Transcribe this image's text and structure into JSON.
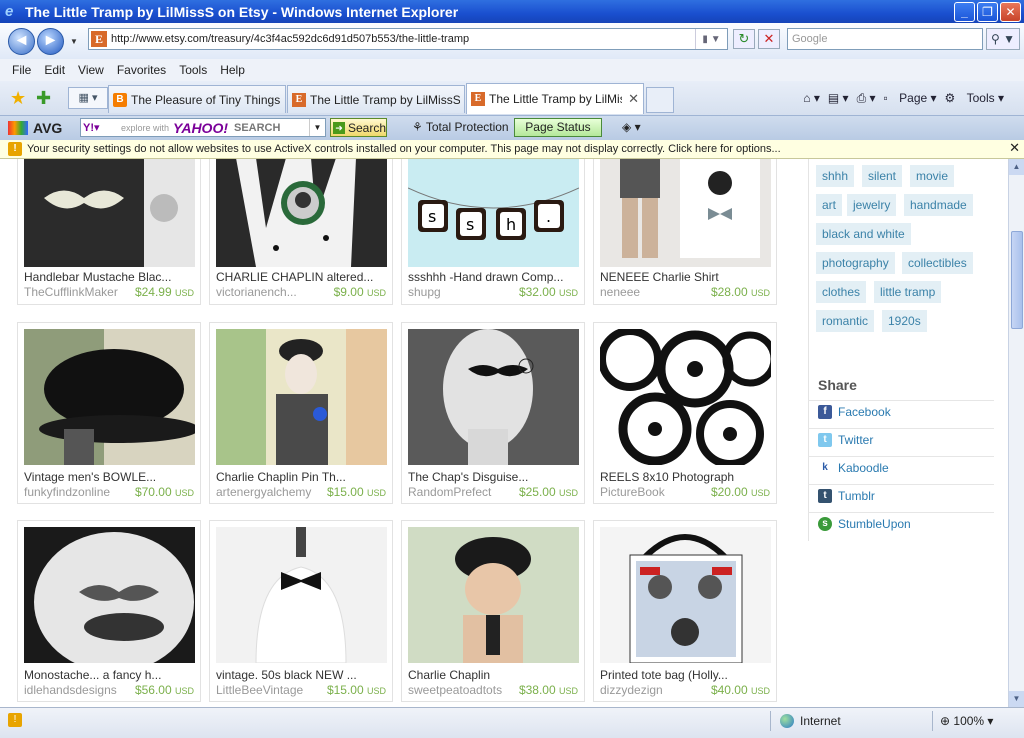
{
  "window": {
    "title": "The Little Tramp by LilMissS on Etsy - Windows Internet Explorer"
  },
  "address": {
    "url": "http://www.etsy.com/treasury/4c3f4ac592dc6d91d507b553/the-little-tramp",
    "search_placeholder": "Google"
  },
  "menu": [
    "File",
    "Edit",
    "View",
    "Favorites",
    "Tools",
    "Help"
  ],
  "tabs": [
    {
      "label": "The Pleasure of Tiny Things: ...",
      "icon": "blogger-icon"
    },
    {
      "label": "The Little Tramp by LilMissS o...",
      "icon": "etsy-icon"
    },
    {
      "label": "The Little Tramp by LilMis...",
      "icon": "etsy-icon",
      "active": true
    }
  ],
  "commands": {
    "page": "Page",
    "tools": "Tools"
  },
  "avg": {
    "brand": "AVG",
    "yahoo_placeholder": "explore with",
    "yahoo_logo": "YAHOO!",
    "yahoo_search": "SEARCH",
    "search_btn": "Search",
    "total_protection": "Total Protection",
    "page_status": "Page Status"
  },
  "security_msg": "Your security settings do not allow websites to use ActiveX controls installed on your computer. This page may not display correctly. Click here for options...",
  "items": [
    {
      "title": "Handlebar Mustache Blac...",
      "shop": "TheCufflinkMaker",
      "price": "$24.99",
      "currency": "USD"
    },
    {
      "title": "CHARLIE CHAPLIN altered...",
      "shop": "victorianench...",
      "price": "$9.00",
      "currency": "USD"
    },
    {
      "title": "ssshhh -Hand drawn Comp...",
      "shop": "shupg",
      "price": "$32.00",
      "currency": "USD"
    },
    {
      "title": "NENEEE Charlie Shirt",
      "shop": "neneee",
      "price": "$28.00",
      "currency": "USD"
    },
    {
      "title": "Vintage men's BOWLE...",
      "shop": "funkyfindzonline",
      "price": "$70.00",
      "currency": "USD"
    },
    {
      "title": "Charlie Chaplin Pin Th...",
      "shop": "artenergyalchemy",
      "price": "$15.00",
      "currency": "USD"
    },
    {
      "title": "The Chap's Disguise...",
      "shop": "RandomPrefect",
      "price": "$25.00",
      "currency": "USD"
    },
    {
      "title": "REELS 8x10 Photograph",
      "shop": "PictureBook",
      "price": "$20.00",
      "currency": "USD"
    },
    {
      "title": "Monostache... a fancy h...",
      "shop": "idlehandsdesigns",
      "price": "$56.00",
      "currency": "USD"
    },
    {
      "title": "vintage. 50s black NEW ...",
      "shop": "LittleBeeVintage",
      "price": "$15.00",
      "currency": "USD"
    },
    {
      "title": "Charlie Chaplin",
      "shop": "sweetpeatoadtots",
      "price": "$38.00",
      "currency": "USD"
    },
    {
      "title": "Printed tote bag (Holly...",
      "shop": "dizzydezign",
      "price": "$40.00",
      "currency": "USD"
    }
  ],
  "tags": [
    "shhh",
    "silent",
    "movie",
    "art",
    "jewelry",
    "handmade",
    "black and white",
    "photography",
    "collectibles",
    "clothes",
    "little tramp",
    "romantic",
    "1920s"
  ],
  "share": {
    "title": "Share",
    "items": [
      "Facebook",
      "Twitter",
      "Kaboodle",
      "Tumblr",
      "StumbleUpon"
    ]
  },
  "status": {
    "zone": "Internet",
    "zoom": "100%"
  }
}
